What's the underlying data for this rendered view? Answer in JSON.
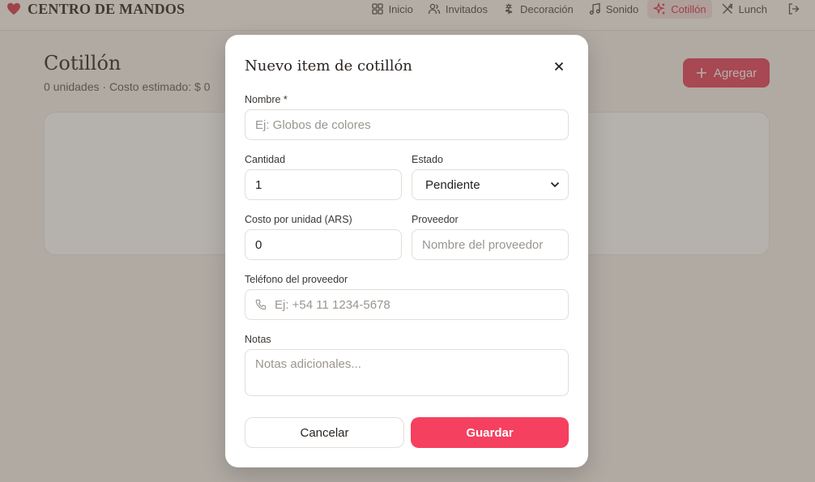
{
  "brand": {
    "title": "CENTRO DE MANDOS",
    "accent_color": "#d6304f"
  },
  "nav": {
    "items": [
      {
        "label": "Inicio",
        "icon": "grid-icon"
      },
      {
        "label": "Invitados",
        "icon": "users-icon"
      },
      {
        "label": "Decoración",
        "icon": "flower-icon"
      },
      {
        "label": "Sonido",
        "icon": "music-icon"
      },
      {
        "label": "Cotillón",
        "icon": "sparkles-icon",
        "active": true
      },
      {
        "label": "Lunch",
        "icon": "utensils-icon"
      }
    ],
    "logout_icon": "logout-icon"
  },
  "page": {
    "title": "Cotillón",
    "subtitle": "0 unidades · Costo estimado: $ 0",
    "add_label": "Agregar",
    "add_color": "#e5405e"
  },
  "modal": {
    "title": "Nuevo item de cotillón",
    "close_label": "×",
    "fields": {
      "nombre": {
        "label": "Nombre *",
        "placeholder": "Ej: Globos de colores",
        "value": ""
      },
      "cantidad": {
        "label": "Cantidad",
        "value": "1"
      },
      "estado": {
        "label": "Estado",
        "value": "Pendiente"
      },
      "costo": {
        "label": "Costo por unidad (ARS)",
        "value": "0"
      },
      "proveedor": {
        "label": "Proveedor",
        "placeholder": "Nombre del proveedor",
        "value": ""
      },
      "telefono": {
        "label": "Teléfono del proveedor",
        "placeholder": "Ej: +54 11 1234-5678",
        "value": ""
      },
      "notas": {
        "label": "Notas",
        "placeholder": "Notas adicionales...",
        "value": ""
      }
    },
    "cancel_label": "Cancelar",
    "save_label": "Guardar",
    "save_color": "#f5405f"
  }
}
